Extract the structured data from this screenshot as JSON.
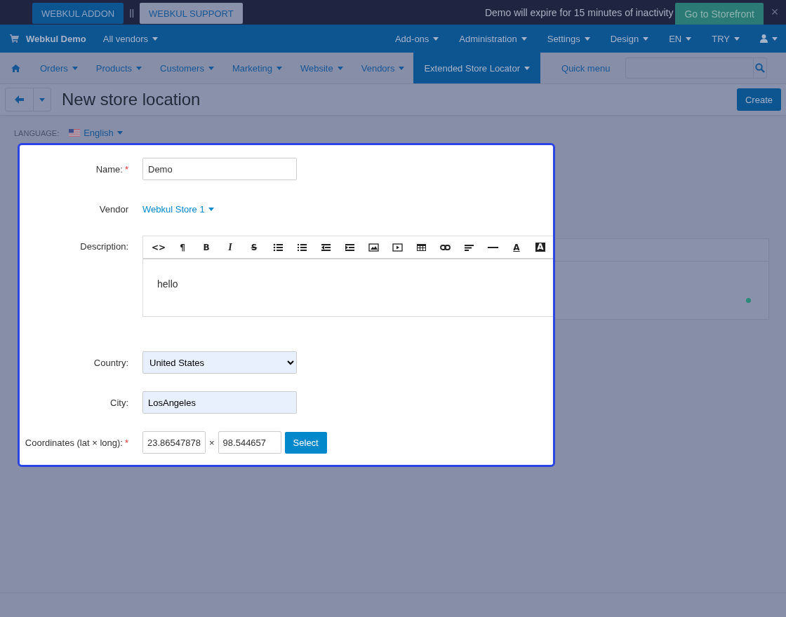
{
  "topbar": {
    "buttons": [
      {
        "label": "WEBKUL ADDON",
        "selected": true
      },
      {
        "label": "WEBKUL SUPPORT",
        "selected": false
      }
    ],
    "separator": "||",
    "notice": "Demo will expire for 15 minutes of inactivity",
    "storefront_button": "Go to Storefront",
    "close": "×"
  },
  "header": {
    "store": "Webkul Demo",
    "vendor_menu": "All vendors",
    "menus": [
      "Add-ons",
      "Administration",
      "Settings",
      "Design",
      "EN",
      "TRY"
    ]
  },
  "nav": {
    "items": [
      {
        "label": "Orders",
        "selected": false
      },
      {
        "label": "Products",
        "selected": false
      },
      {
        "label": "Customers",
        "selected": false
      },
      {
        "label": "Marketing",
        "selected": false
      },
      {
        "label": "Website",
        "selected": false
      },
      {
        "label": "Vendors",
        "selected": false
      },
      {
        "label": "Extended Store Locator",
        "selected": true
      }
    ],
    "quick_menu": "Quick menu"
  },
  "page": {
    "title": "New store location",
    "create_button": "Create",
    "language_label": "LANGUAGE:",
    "language": "English"
  },
  "toolbar": [
    {
      "kind": "glyph",
      "glyph": "<>"
    },
    {
      "kind": "glyph",
      "glyph": "¶"
    },
    {
      "kind": "glyph",
      "glyph": "B"
    },
    {
      "kind": "italic",
      "glyph": "I"
    },
    {
      "kind": "strike",
      "glyph": "S"
    },
    {
      "kind": "ul"
    },
    {
      "kind": "ol"
    },
    {
      "kind": "outdent"
    },
    {
      "kind": "indent"
    },
    {
      "kind": "image"
    },
    {
      "kind": "video"
    },
    {
      "kind": "table"
    },
    {
      "kind": "link"
    },
    {
      "kind": "align"
    },
    {
      "kind": "rule"
    },
    {
      "kind": "underline",
      "glyph": "A"
    },
    {
      "kind": "inverse",
      "glyph": "A"
    }
  ],
  "form": {
    "fields": [
      {
        "kind": "text",
        "label": "Name:",
        "mark": "*",
        "value": "Demo",
        "autofilled": false
      },
      {
        "kind": "link",
        "label": "Vendor",
        "value": "Webkul Store 1"
      },
      {
        "kind": "editor",
        "label": "Description:",
        "value": "hello"
      },
      {
        "kind": "select",
        "label": "Country:",
        "value": "United States",
        "autofilled": true
      },
      {
        "kind": "text",
        "label": "City:",
        "value": "LosAngeles",
        "autofilled": true
      },
      {
        "kind": "coords",
        "label": "Coordinates (lat × long):",
        "mark": "*",
        "lat": "23.86547878",
        "separator": "×",
        "long": "98.544657",
        "button": "Select"
      }
    ]
  }
}
